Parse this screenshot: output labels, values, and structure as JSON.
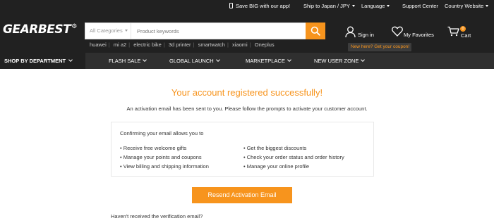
{
  "topbar": {
    "app_promo": "Save BIG with our app!",
    "ship_to": "Ship to Japan / JPY",
    "language": "Language",
    "support": "Support Center",
    "country": "Country Website"
  },
  "header": {
    "logo": "GEARBEST",
    "search": {
      "category": "All Categories",
      "placeholder": "Product keywords"
    },
    "hot_words": [
      "huawei",
      "mi a2",
      "electric bike",
      "3d printer",
      "smartwatch",
      "xiaomi",
      "Oneplus"
    ],
    "sign_in": "Sign in",
    "favorites": "My Favorites",
    "cart": "Cart",
    "cart_count": "0",
    "coupon": "New here? Get your coupon!"
  },
  "nav": {
    "department": "SHOP BY DEPARTMENT",
    "items": [
      "FLASH SALE",
      "GLOBAL LAUNCH",
      "MARKETPLACE",
      "NEW USER ZONE"
    ]
  },
  "main": {
    "title": "Your account registered successfully!",
    "message": "An activation email has been sent to you. Please follow the prompts to activate your customer account.",
    "benefits_heading": "Confirming your email allows you to",
    "benefits_left": [
      "• Receive free welcome gifts",
      "• Manage your points and coupons",
      "• View billing and shipping information"
    ],
    "benefits_right": [
      "• Get the biggest discounts",
      "• Check your order status and order history",
      "• Manage your online profile"
    ],
    "resend_button": "Resend Activation Email",
    "not_received": "Haven't received the verification email?"
  },
  "colors": {
    "accent": "#f7941d",
    "header_bg": "#212121",
    "nav_bg": "#2f2f2f"
  }
}
